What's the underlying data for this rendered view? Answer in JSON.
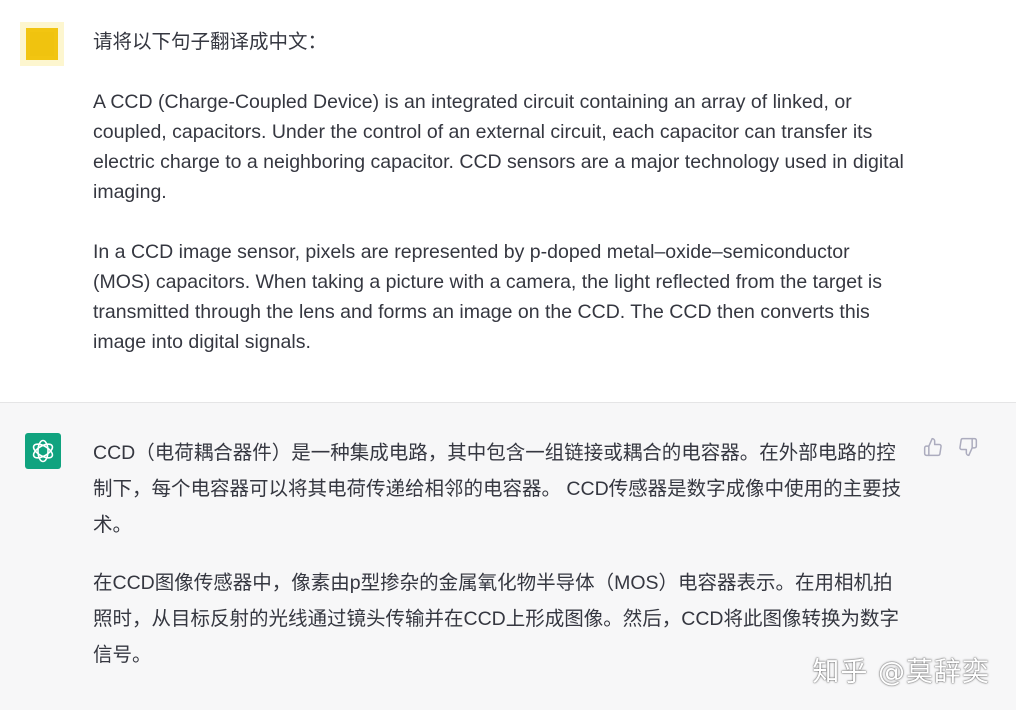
{
  "user_message": {
    "avatar": "pixelated-yellow-avatar",
    "instruction": "请将以下句子翻译成中文：",
    "paragraphs": [
      "A CCD (Charge-Coupled Device) is an integrated circuit containing an array of linked, or coupled, capacitors. Under the control of an external circuit, each capacitor can transfer its electric charge to a neighboring capacitor. CCD sensors are a major technology used in digital imaging.",
      "In a CCD image sensor, pixels are represented by p-doped metal–oxide–semiconductor (MOS) capacitors. When taking a picture with a camera, the light reflected from the target is transmitted through the lens and forms an image on the CCD. The CCD then converts this image into digital signals."
    ]
  },
  "assistant_message": {
    "avatar": "openai-logo-icon",
    "avatar_color": "#10a37f",
    "paragraphs": [
      "CCD（电荷耦合器件）是一种集成电路，其中包含一组链接或耦合的电容器。在外部电路的控制下，每个电容器可以将其电荷传递给相邻的电容器。 CCD传感器是数字成像中使用的主要技术。",
      "在CCD图像传感器中，像素由p型掺杂的金属氧化物半导体（MOS）电容器表示。在用相机拍照时，从目标反射的光线通过镜头传输并在CCD上形成图像。然后，CCD将此图像转换为数字信号。"
    ],
    "feedback": {
      "thumbs_up": "thumbs-up-icon",
      "thumbs_down": "thumbs-down-icon"
    }
  },
  "watermark": "知乎 @莫辞奕"
}
